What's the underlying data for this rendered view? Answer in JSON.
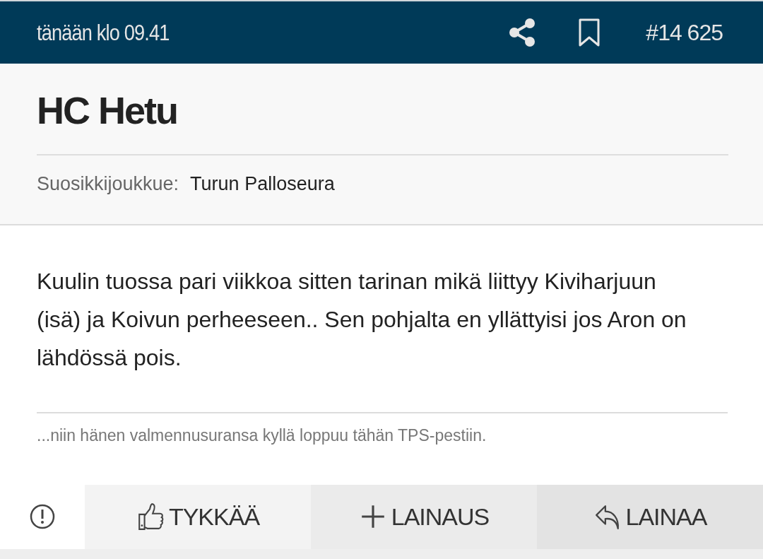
{
  "header": {
    "timestamp": "tänään klo 09.41",
    "post_number": "#14 625"
  },
  "author": {
    "name": "HC Hetu",
    "favorite_team_label": "Suosikkijoukkue:",
    "favorite_team": "Turun Palloseura"
  },
  "post": {
    "body": "Kuulin tuossa pari viikkoa sitten tarinan mikä liittyy Kiviharjuun (isä) ja Koivun perheeseen.. Sen pohjalta en yllättyisi jos Aron on lähdössä pois.",
    "quote_excerpt": "...niin hänen valmennusuransa kyllä loppuu tähän TPS-pestiin."
  },
  "actions": [
    {
      "kind": "like",
      "label": "TYKKÄÄ"
    },
    {
      "kind": "add_quote",
      "label": "LAINAUS"
    },
    {
      "kind": "quote",
      "label": "LAINAA"
    }
  ]
}
